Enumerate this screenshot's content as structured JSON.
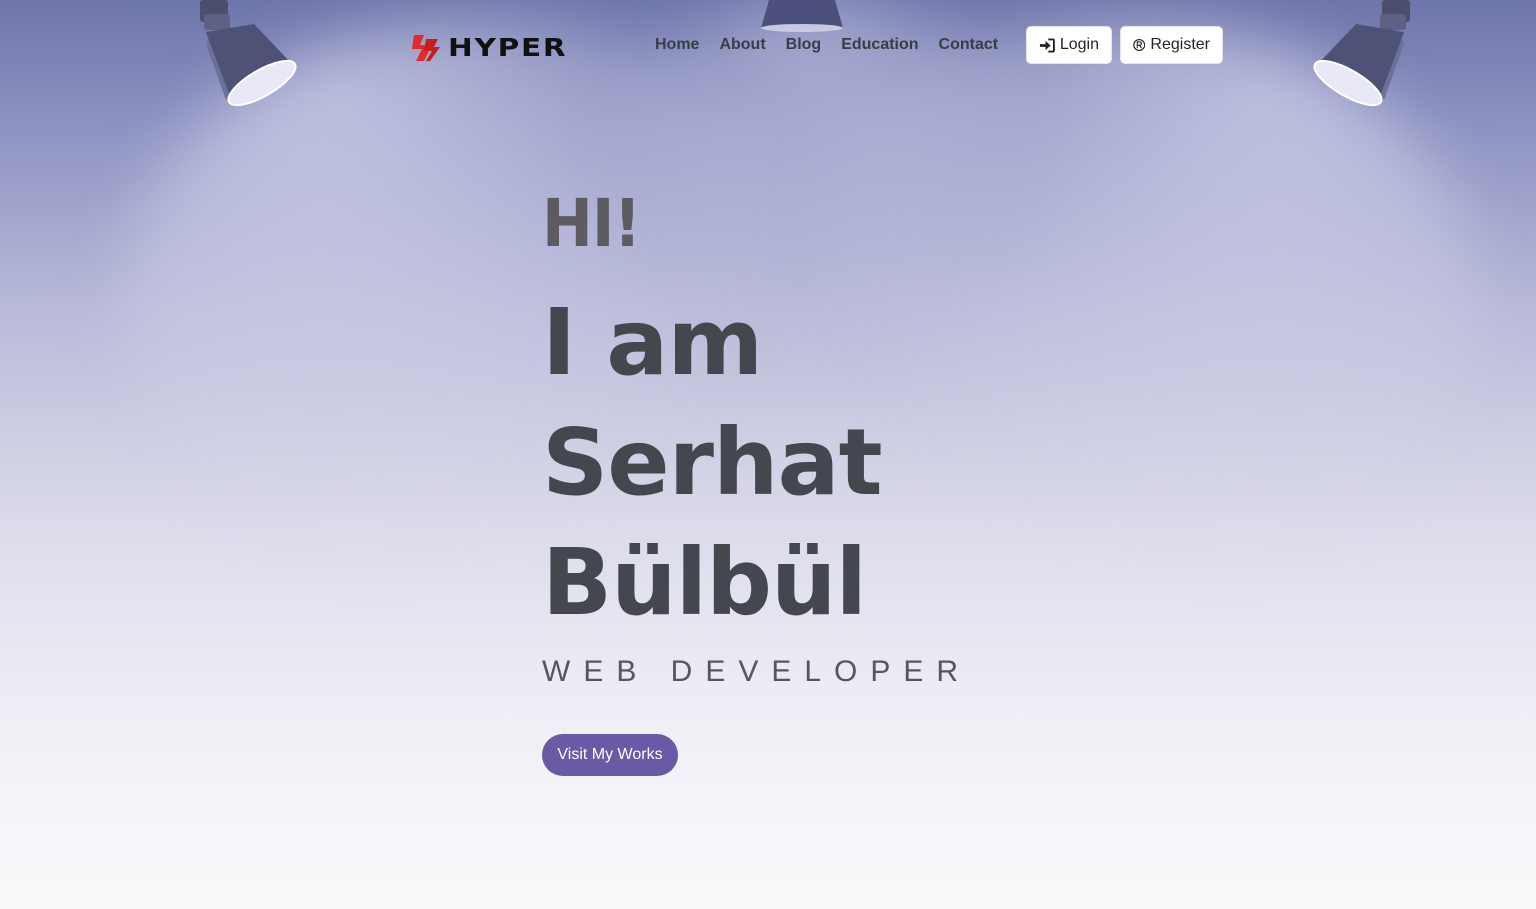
{
  "brand": {
    "name": "HYPER",
    "accent_color": "#e22b2b"
  },
  "nav": {
    "links": [
      "Home",
      "About",
      "Blog",
      "Education",
      "Contact"
    ],
    "login_label": "Login",
    "register_label": "Register",
    "login_icon": "sign-in-icon",
    "register_icon": "registered-icon"
  },
  "hero": {
    "greeting": "HI!",
    "line_1": "I am",
    "line_2": "Serhat",
    "line_3": "Bülbül",
    "role": "WEB DEVELOPER",
    "cta_label": "Visit My Works",
    "cta_color": "#6a5aa6"
  }
}
